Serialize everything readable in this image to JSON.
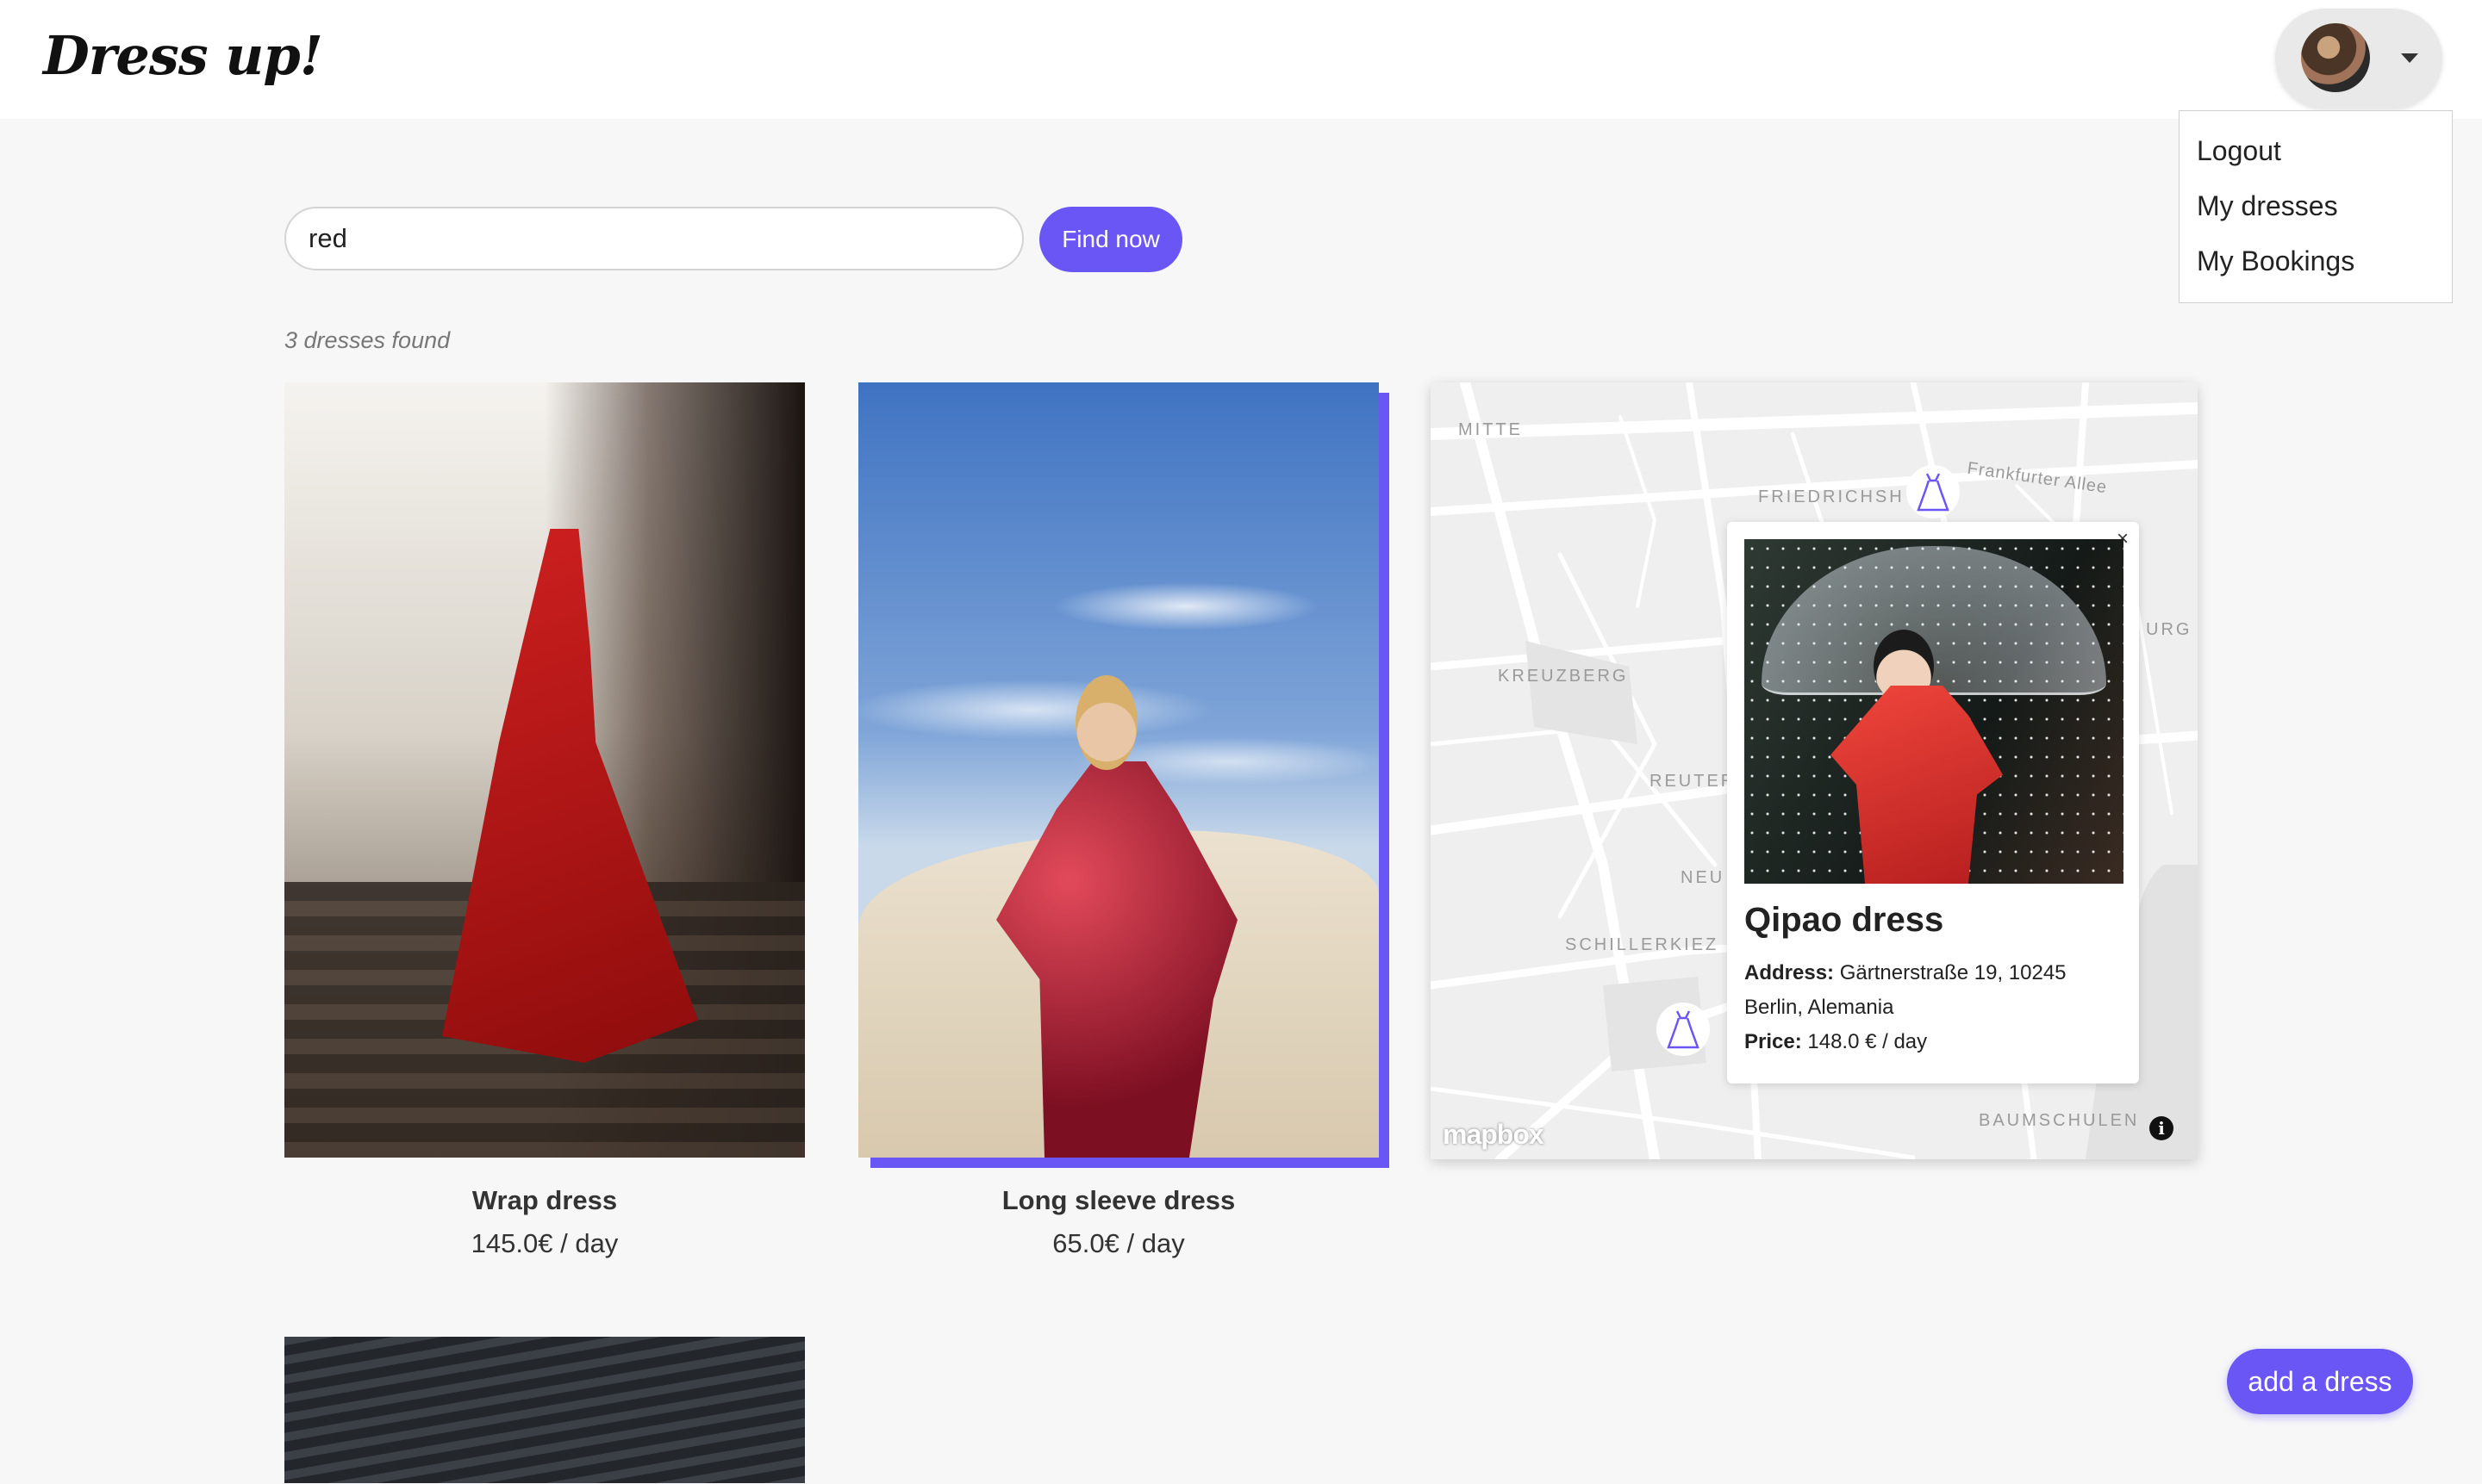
{
  "navbar": {
    "logo": "Dress up!",
    "user_menu": {
      "items": [
        {
          "label": "Logout"
        },
        {
          "label": "My dresses"
        },
        {
          "label": "My Bookings"
        }
      ]
    }
  },
  "search": {
    "value": "red",
    "button_label": "Find now"
  },
  "results": {
    "count_text": "3 dresses found",
    "dresses": [
      {
        "name": "Wrap dress",
        "price": "145.0€ / day"
      },
      {
        "name": "Long sleeve dress",
        "price": "65.0€ / day"
      },
      {
        "name": "",
        "price": ""
      }
    ]
  },
  "map": {
    "labels": [
      "MITTE",
      "FRIEDRICHSH",
      "Frankfurter Allee",
      "KREUZBERG",
      "REUTER",
      "NEU",
      "SCHILLERKIEZ",
      "BAUMSCHULEN",
      "URG"
    ],
    "popup": {
      "title": "Qipao dress",
      "address_label": "Address:",
      "address_line1": "Gärtnerstraße 19, 10245",
      "address_line2": "Berlin, Alemania",
      "price_label": "Price:",
      "price_value": "148.0 € / day",
      "close": "×"
    },
    "attribution_logo": "mapbox",
    "info_icon": "i"
  },
  "fab": {
    "label": "add a dress"
  },
  "colors": {
    "accent": "#6a55f5",
    "background": "#f7f7f7"
  }
}
